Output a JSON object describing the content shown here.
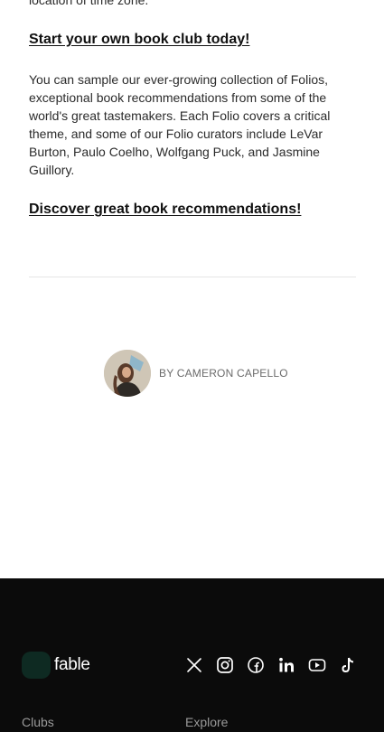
{
  "article": {
    "cut_text": "location of time zone.",
    "cta_1": "Start your own book club today!",
    "paragraph": "You can sample our ever-growing collection of Folios, exceptional book recommendations from some of the world's great tastemakers. Each Folio covers a critical theme, and some of our Folio curators include LeVar Burton, Paulo Coelho, Wolfgang Puck, and Jasmine Guillory.",
    "cta_2": "Discover great book recommendations!"
  },
  "author": {
    "byline": "BY CAMERON CAPELLO"
  },
  "footer": {
    "logo_text": "fable",
    "socials": [
      "x-icon",
      "instagram-icon",
      "facebook-icon",
      "linkedin-icon",
      "youtube-icon",
      "tiktok-icon"
    ],
    "col_1": "Clubs",
    "col_2": "Explore"
  },
  "colors": {
    "footer_bg": "#0b0b0b",
    "logo_mark": "#0e2a22"
  }
}
